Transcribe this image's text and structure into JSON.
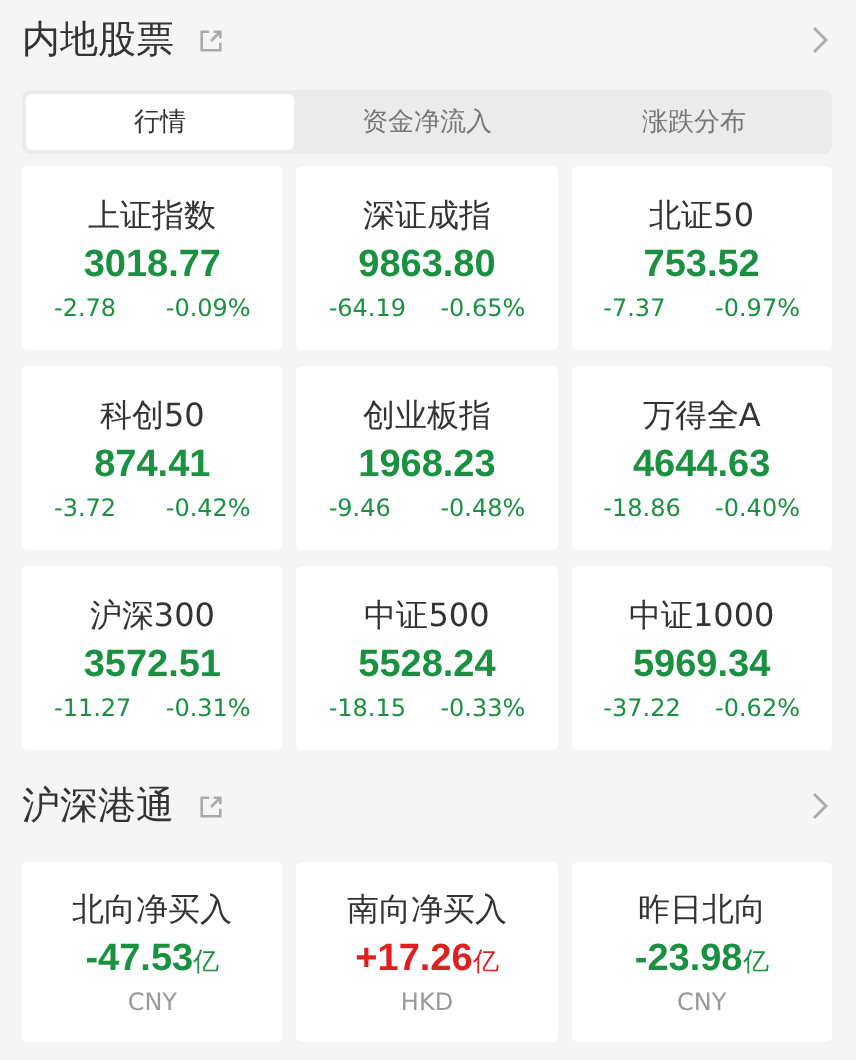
{
  "mainland": {
    "title": "内地股票",
    "tabs": [
      {
        "label": "行情",
        "selected": true
      },
      {
        "label": "资金净流入",
        "selected": false
      },
      {
        "label": "涨跌分布",
        "selected": false
      }
    ],
    "indices": [
      {
        "name": "上证指数",
        "value": "3018.77",
        "change": "-2.78",
        "percent": "-0.09%",
        "color": "#1a9140"
      },
      {
        "name": "深证成指",
        "value": "9863.80",
        "change": "-64.19",
        "percent": "-0.65%",
        "color": "#1a9140"
      },
      {
        "name": "北证50",
        "value": "753.52",
        "change": "-7.37",
        "percent": "-0.97%",
        "color": "#1a9140"
      },
      {
        "name": "科创50",
        "value": "874.41",
        "change": "-3.72",
        "percent": "-0.42%",
        "color": "#1a9140"
      },
      {
        "name": "创业板指",
        "value": "1968.23",
        "change": "-9.46",
        "percent": "-0.48%",
        "color": "#1a9140"
      },
      {
        "name": "万得全A",
        "value": "4644.63",
        "change": "-18.86",
        "percent": "-0.40%",
        "color": "#1a9140"
      },
      {
        "name": "沪深300",
        "value": "3572.51",
        "change": "-11.27",
        "percent": "-0.31%",
        "color": "#1a9140"
      },
      {
        "name": "中证500",
        "value": "5528.24",
        "change": "-18.15",
        "percent": "-0.33%",
        "color": "#1a9140"
      },
      {
        "name": "中证1000",
        "value": "5969.34",
        "change": "-37.22",
        "percent": "-0.62%",
        "color": "#1a9140"
      }
    ]
  },
  "connect": {
    "title": "沪深港通",
    "flows": [
      {
        "name": "北向净买入",
        "value": "-47.53",
        "unit": "亿",
        "currency": "CNY",
        "color": "#1a9140"
      },
      {
        "name": "南向净买入",
        "value": "+17.26",
        "unit": "亿",
        "currency": "HKD",
        "color": "#e02020"
      },
      {
        "name": "昨日北向",
        "value": "-23.98",
        "unit": "亿",
        "currency": "CNY",
        "color": "#1a9140"
      }
    ]
  }
}
